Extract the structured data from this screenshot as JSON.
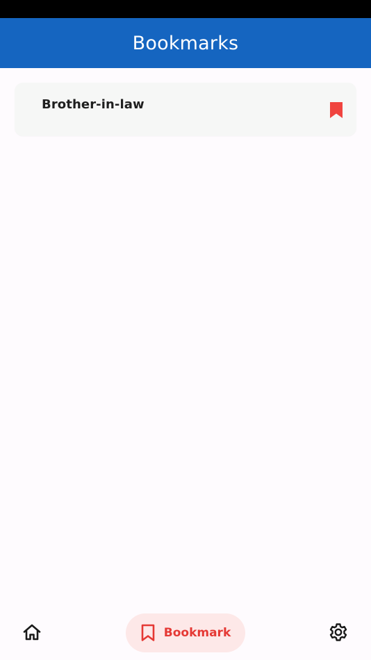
{
  "app_bar": {
    "title": "Bookmarks"
  },
  "bookmarks": {
    "items": [
      {
        "title": "Brother-in-law",
        "icon": "bookmark-filled-icon",
        "bookmarked": true
      }
    ]
  },
  "bottom_nav": {
    "items": [
      {
        "icon": "home-icon",
        "label": "",
        "selected": false
      },
      {
        "icon": "bookmark-outline-icon",
        "label": "Bookmark",
        "selected": true
      },
      {
        "icon": "gear-icon",
        "label": "",
        "selected": false
      }
    ]
  },
  "colors": {
    "app_bar": "#1565c0",
    "accent": "#e53935",
    "selected_pill": "#fde8e8",
    "card": "#f6f7f6",
    "background": "#fefbfe",
    "status_bar": "#000000"
  }
}
